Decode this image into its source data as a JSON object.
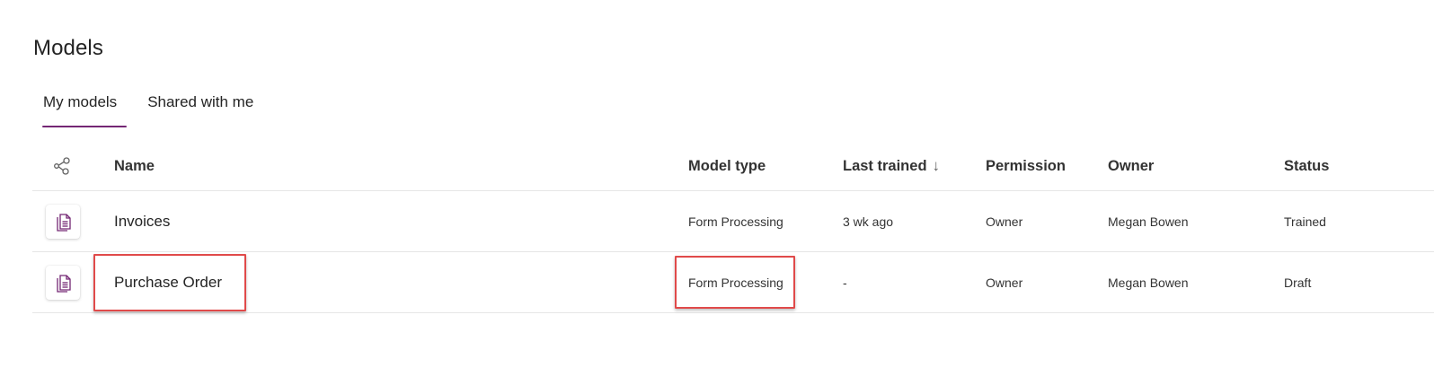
{
  "page": {
    "title": "Models"
  },
  "tabs": [
    {
      "label": "My models",
      "active": true
    },
    {
      "label": "Shared with me",
      "active": false
    }
  ],
  "table": {
    "columns": {
      "icon": "connections-icon",
      "name": "Name",
      "model_type": "Model type",
      "last_trained": "Last trained",
      "last_trained_sort": "↓",
      "permission": "Permission",
      "owner": "Owner",
      "status": "Status"
    },
    "rows": [
      {
        "icon": "form-document-icon",
        "name": "Invoices",
        "model_type": "Form Processing",
        "last_trained": "3 wk ago",
        "permission": "Owner",
        "owner": "Megan Bowen",
        "status": "Trained"
      },
      {
        "icon": "form-document-icon",
        "name": "Purchase Order",
        "model_type": "Form Processing",
        "last_trained": "-",
        "permission": "Owner",
        "owner": "Megan Bowen",
        "status": "Draft"
      }
    ]
  },
  "colors": {
    "accent": "#742774",
    "highlight_box": "#e04a4a"
  }
}
